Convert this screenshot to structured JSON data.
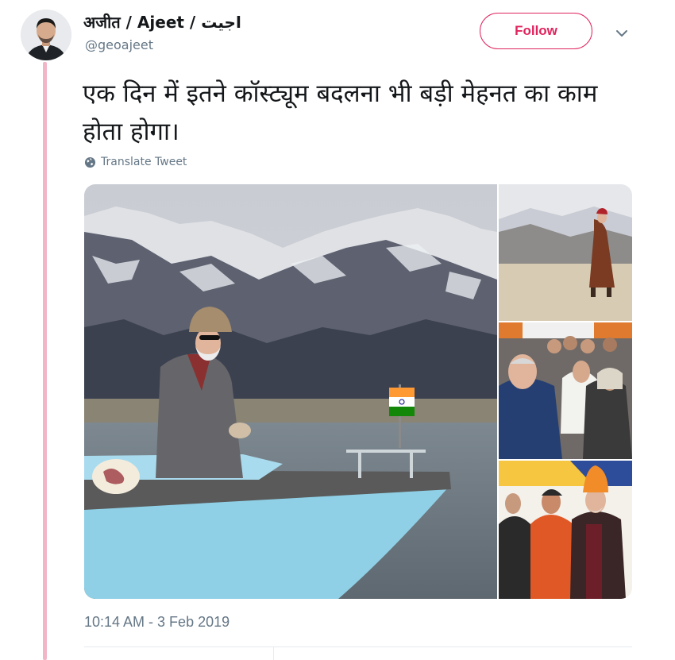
{
  "tweet": {
    "display_name": "अजीत / Ajeet / اجیت",
    "handle": "@geoajeet",
    "follow_label": "Follow",
    "text": "एक दिन में इतने कॉस्ट्यूम बदलना भी बड़ी मेहनत का काम होता होगा।",
    "translate_label": "Translate Tweet",
    "timestamp": "10:14 AM - 3 Feb 2019"
  },
  "media": {
    "main_photo": "man-in-grey-coat-and-cap-on-blue-boat-before-snowy-mountains",
    "side_photos": [
      "man-in-brown-robe-walking-in-desert-mountain-landscape",
      "man-greeting-women-in-headscarves-in-crowd",
      "man-in-orange-turban-with-folded-hands-on-stage"
    ]
  },
  "colors": {
    "follow_accent": "#e0245e",
    "thread_line": "#f2b5c8",
    "secondary_text": "#657786",
    "boat_blue": "#8fd0e6"
  }
}
